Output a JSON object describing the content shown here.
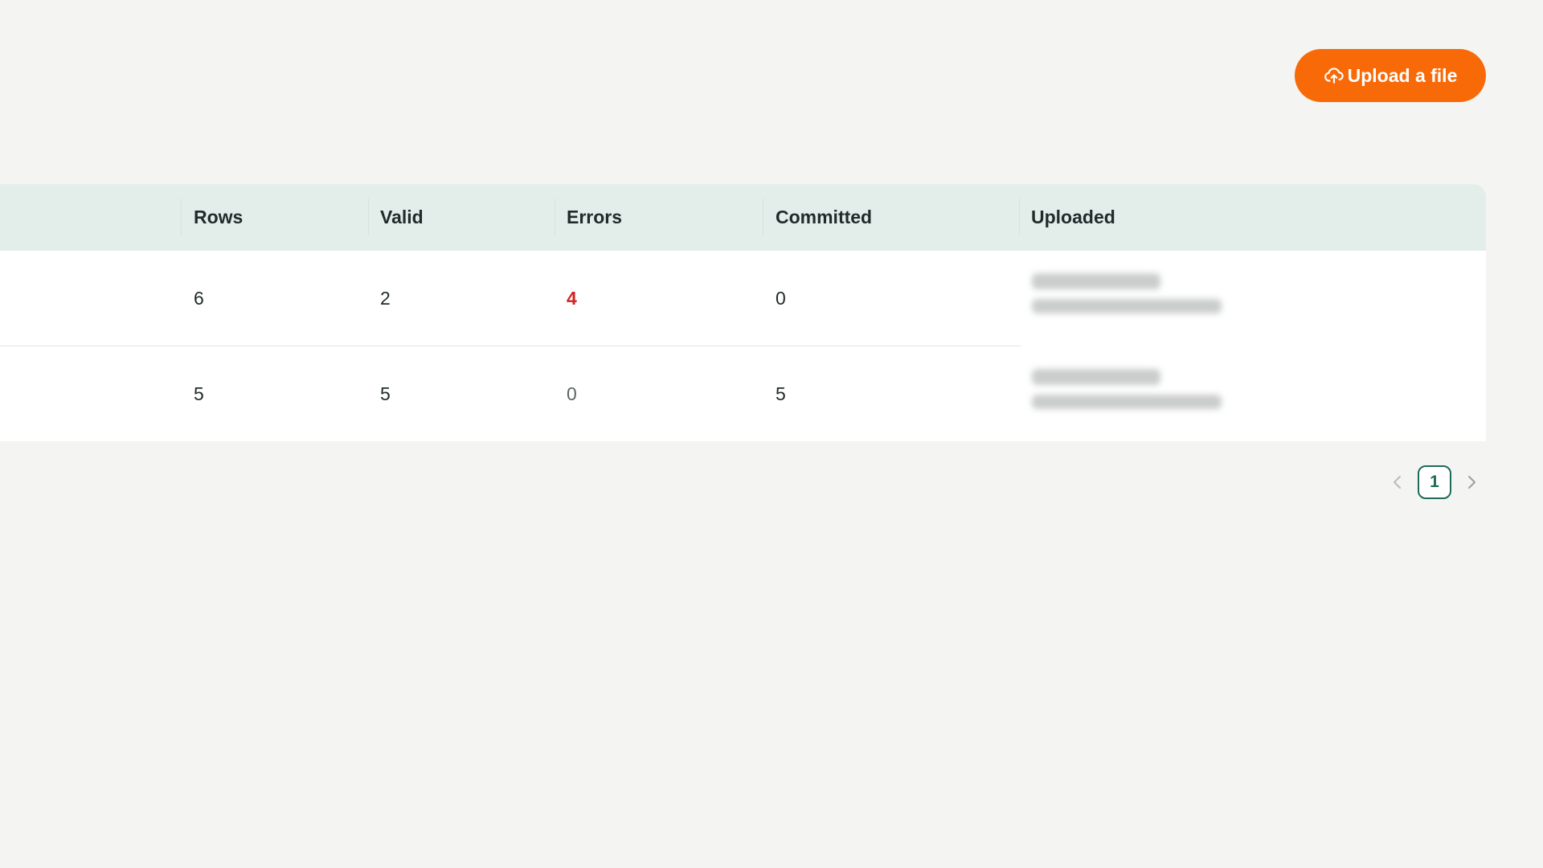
{
  "toolbar": {
    "upload_label": "Upload a file",
    "upload_icon": "cloud-upload-icon",
    "accent_color": "#f86a08"
  },
  "table": {
    "columns": [
      "Rows",
      "Valid",
      "Errors",
      "Committed",
      "Uploaded"
    ],
    "rows": [
      {
        "rows": "6",
        "valid": "2",
        "errors": "4",
        "committed": "0"
      },
      {
        "rows": "5",
        "valid": "5",
        "errors": "0",
        "committed": "5"
      }
    ],
    "error_color": "#d32222",
    "header_color": "#e3eeeb"
  },
  "pagination": {
    "current_page": "1",
    "prev_icon": "chevron-left-icon",
    "next_icon": "chevron-right-icon",
    "active_color": "#1d6b5b"
  }
}
